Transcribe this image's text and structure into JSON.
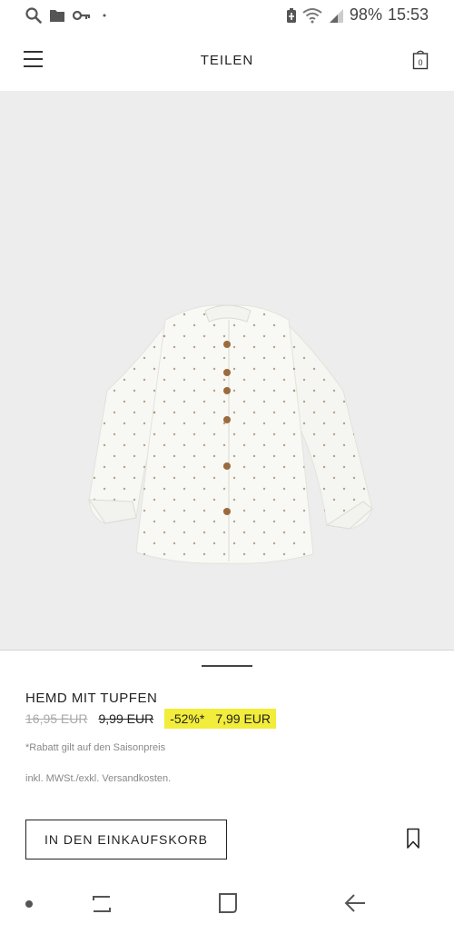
{
  "status_bar": {
    "icons": [
      "search-icon",
      "folder-icon",
      "key-icon",
      "dot-icon",
      "battery-saver-icon",
      "wifi-icon",
      "signal-icon"
    ],
    "battery": "98%",
    "time": "15:53"
  },
  "header": {
    "menu_icon": "hamburger-menu-icon",
    "title": "TEILEN",
    "cart_count": "0",
    "cart_icon": "shopping-bag-icon"
  },
  "product": {
    "image": "white-shirt-with-dots",
    "name": "HEMD MIT TUPFEN",
    "price_original": "16,95 EUR",
    "price_season": "9,99 EUR",
    "discount": "-52%*",
    "price_final": "7,99 EUR",
    "disclaimer": "*Rabatt gilt auf den Saisonpreis",
    "vat_note": "inkl. MWSt./exkl. Versandkosten.",
    "add_to_cart_label": "IN DEN EINKAUFSKORB",
    "bookmark_icon": "bookmark-icon",
    "highlight_color": "#f2ec3a"
  },
  "nav_bar": {
    "icons": [
      "dot-icon",
      "recent-apps-icon",
      "home-icon",
      "back-icon"
    ]
  }
}
